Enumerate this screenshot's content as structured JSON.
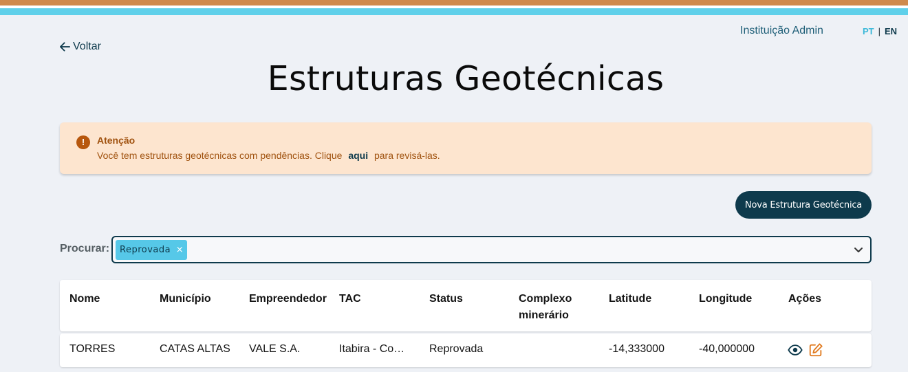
{
  "header": {
    "user": "Instituição Admin",
    "lang_pt": "PT",
    "lang_sep": "|",
    "lang_en": "EN"
  },
  "nav": {
    "back_label": "Voltar"
  },
  "page": {
    "title": "Estruturas Geotécnicas"
  },
  "alert": {
    "heading": "Atenção",
    "msg_before": "Você tem estruturas geotécnicas com pendências. Clique",
    "msg_link": "aqui",
    "msg_after": "para revisá-las."
  },
  "actions_bar": {
    "new_button": "Nova Estrutura Geotécnica"
  },
  "search": {
    "label": "Procurar:",
    "chip": "Reprovada",
    "chip_remove": "×"
  },
  "table": {
    "headers": [
      "Nome",
      "Município",
      "Empreendedor",
      "TAC",
      "Status",
      "Complexo minerário",
      "Latitude",
      "Longitude",
      "Ações"
    ],
    "rows": [
      {
        "nome": "TORRES",
        "municipio": "CATAS ALTAS",
        "empreendedor": "VALE S.A.",
        "tac": "Itabira - Com...",
        "status": "Reprovada",
        "complexo": "",
        "latitude": "-14,333000",
        "longitude": "-40,000000"
      }
    ]
  },
  "colors": {
    "primary": "#0e3a4c",
    "accent_blue": "#56c8e8",
    "stripe_orange": "#cf8a4c",
    "alert_bg": "#fde5cf",
    "alert_text": "#a0520f",
    "edit_orange": "#e07a1f"
  },
  "icons": {
    "back": "arrow-left-icon",
    "alert": "exclamation-circle-icon",
    "dropdown": "chevron-down-icon",
    "view": "eye-icon",
    "edit": "edit-icon"
  }
}
